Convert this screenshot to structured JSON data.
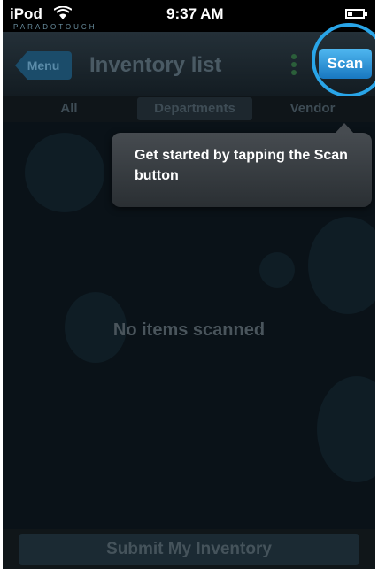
{
  "status_bar": {
    "carrier": "iPod",
    "time": "9:37 AM",
    "brand": "PARADOTOUCH",
    "wifi_icon": "wifi-icon",
    "battery_icon": "battery-icon",
    "battery_level": 0.3
  },
  "navbar": {
    "menu_label": "Menu",
    "title": "Inventory list",
    "scan_label": "Scan",
    "more_icon": "vertical-dots-icon",
    "accent_color": "#29a5e8"
  },
  "segments": {
    "items": [
      {
        "label": "All"
      },
      {
        "label": "Departments"
      },
      {
        "label": "Vendor"
      }
    ],
    "selected": "Departments"
  },
  "tooltip": {
    "text": "Get started by tapping the Scan button"
  },
  "main": {
    "empty_text": "No items scanned"
  },
  "footer": {
    "submit_label": "Submit My Inventory"
  }
}
